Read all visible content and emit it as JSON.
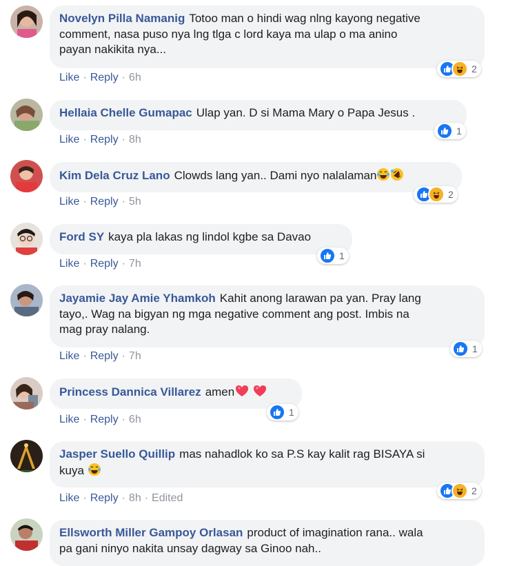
{
  "colors": {
    "author": "#385898",
    "bubble": "#f2f3f5",
    "like_blue": "#1877f2",
    "haha_yellow": "#f7b125",
    "love_red": "#f33e58"
  },
  "actions": {
    "like": "Like",
    "reply": "Reply",
    "dot": "·"
  },
  "comments": [
    {
      "author": "Novelyn Pilla Namanig",
      "text_lines": [
        "Totoo man o hindi wag nlng kayong negative",
        "comment, nasa puso nya lng tlga c lord kaya ma ulap o ma anino",
        "payan nakikita nya..."
      ],
      "time": "6h",
      "edited": "",
      "reactions": [
        "like-icon",
        "haha-icon"
      ],
      "reaction_count": "2"
    },
    {
      "author": "Hellaia Chelle Gumapac",
      "text_lines": [
        "Ulap yan. D si Mama Mary o Papa Jesus ."
      ],
      "time": "8h",
      "edited": "",
      "reactions": [
        "like-icon"
      ],
      "reaction_count": "1"
    },
    {
      "author": "Kim Dela Cruz Lano",
      "text_lines": [
        "Clowds lang yan.. Dami nyo nalalaman"
      ],
      "emojis": [
        "tears-of-joy-emoji",
        "rolling-laughing-emoji"
      ],
      "time": "5h",
      "edited": "",
      "reactions": [
        "like-icon",
        "haha-icon"
      ],
      "reaction_count": "2"
    },
    {
      "author": "Ford SY",
      "text_lines": [
        "kaya pla lakas ng lindol kgbe sa Davao"
      ],
      "time": "7h",
      "edited": "",
      "reactions": [
        "like-icon"
      ],
      "reaction_count": "1"
    },
    {
      "author": "Jayamie Jay Amie Yhamkoh",
      "text_lines": [
        "Kahit anong larawan pa yan. Pray lang",
        "tayo,. Wag na bigyan ng mga negative comment ang post. Imbis na",
        "mag pray nalang."
      ],
      "time": "7h",
      "edited": "",
      "reactions": [
        "like-icon"
      ],
      "reaction_count": "1"
    },
    {
      "author": "Princess Dannica Villarez",
      "text_lines": [
        "amen"
      ],
      "emojis": [
        "heart-emoji",
        "heart-emoji"
      ],
      "time": "6h",
      "edited": "",
      "reactions": [
        "like-icon"
      ],
      "reaction_count": "1"
    },
    {
      "author": "Jasper Suello Quillip",
      "text_lines": [
        "mas nahadlok ko sa P.S kay kalit rag BISAYA si",
        "kuya"
      ],
      "emojis": [
        "tears-of-joy-emoji"
      ],
      "time": "8h",
      "edited": "Edited",
      "reactions": [
        "like-icon",
        "haha-icon"
      ],
      "reaction_count": "2"
    },
    {
      "author": "Ellsworth Miller Gampoy Orlasan",
      "text_lines": [
        "product of imagination rana.. wala",
        "pa gani ninyo nakita unsay dagway sa Ginoo nah.."
      ],
      "time": "",
      "edited": "",
      "reactions": [],
      "reaction_count": ""
    }
  ]
}
